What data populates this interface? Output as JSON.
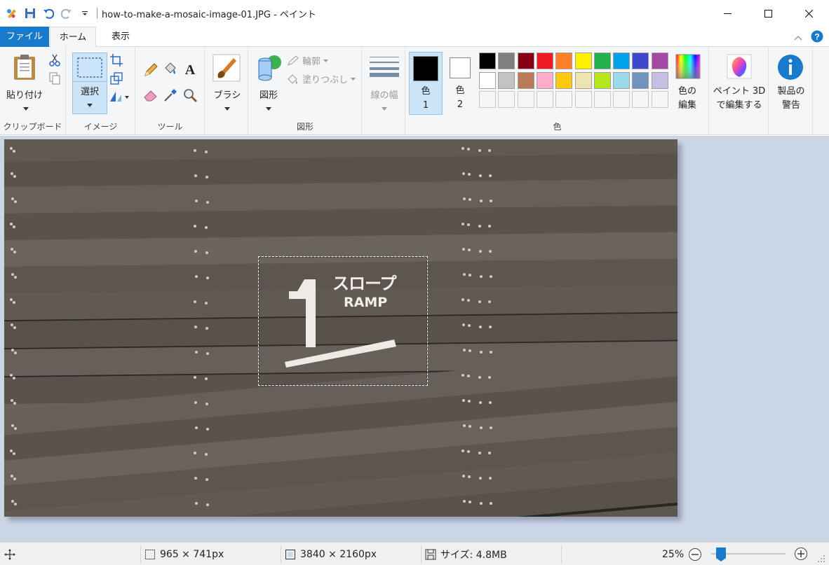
{
  "window": {
    "title": "how-to-make-a-mosaic-image-01.JPG - ペイント"
  },
  "tabs": {
    "file": "ファイル",
    "home": "ホーム",
    "view": "表示"
  },
  "ribbon": {
    "clipboard": {
      "paste": "貼り付け",
      "group": "クリップボード"
    },
    "image": {
      "select": "選択",
      "group": "イメージ"
    },
    "tools": {
      "group": "ツール"
    },
    "brush": {
      "label": "ブラシ"
    },
    "shapes": {
      "label": "図形",
      "outline": "輪郭",
      "fill": "塗りつぶし",
      "group": "図形"
    },
    "size": {
      "label": "線の幅"
    },
    "colors": {
      "color1_line1": "色",
      "color1_line2": "1",
      "color2_line1": "色",
      "color2_line2": "2",
      "edit_line1": "色の",
      "edit_line2": "編集",
      "group": "色",
      "palette_row1": [
        "#000000",
        "#7f7f7f",
        "#880015",
        "#ed1c24",
        "#ff7f27",
        "#fff200",
        "#22b14c",
        "#00a2e8",
        "#3f48cc",
        "#a349a4"
      ],
      "palette_row2": [
        "#ffffff",
        "#c3c3c3",
        "#b97a57",
        "#ffaec9",
        "#ffc90e",
        "#efe4b0",
        "#b5e61d",
        "#99d9ea",
        "#7092be",
        "#c8bfe7"
      ],
      "primary": "#000000",
      "secondary": "#ffffff"
    },
    "paint3d": {
      "line1": "ペイント 3D",
      "line2": "で編集する"
    },
    "warning": {
      "line1": "製品の",
      "line2": "警告"
    }
  },
  "canvas": {
    "sign_line1": "スロープ",
    "sign_line2": "RAMP",
    "sign_number": "1"
  },
  "status": {
    "selection_size": "965 × 741px",
    "image_size": "3840 × 2160px",
    "file_size": "サイズ: 4.8MB",
    "zoom": "25%"
  }
}
